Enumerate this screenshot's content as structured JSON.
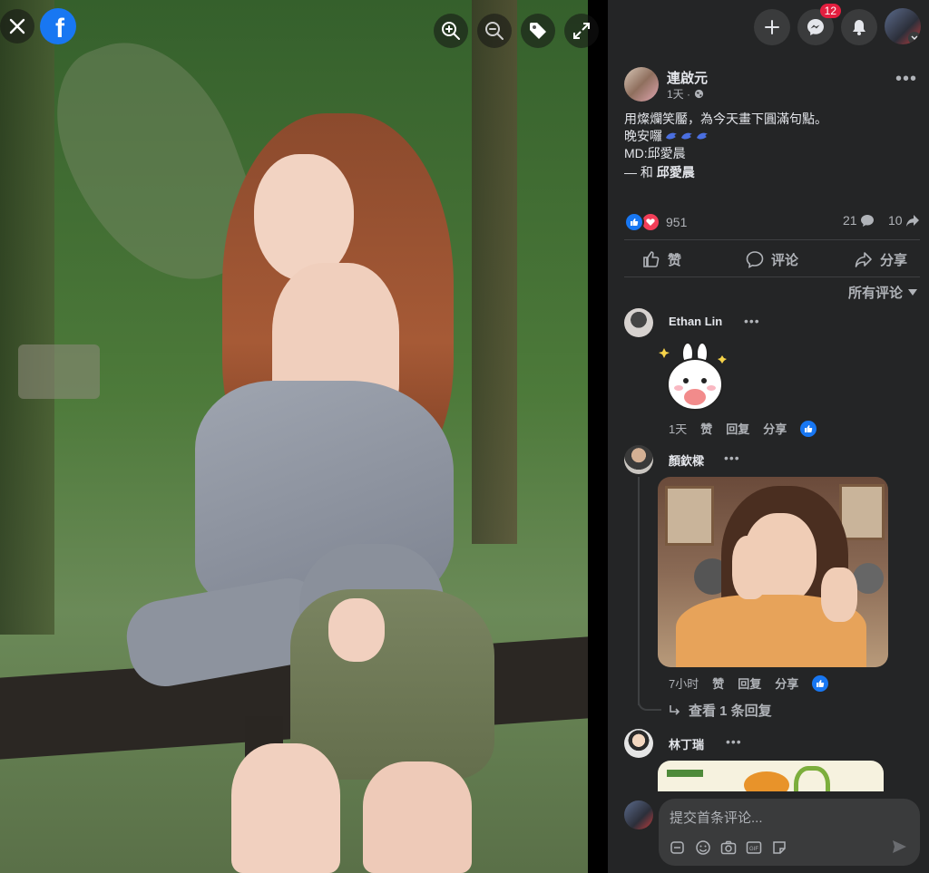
{
  "post": {
    "author": "連啟元",
    "time": "1天 ·",
    "caption_line1": "用燦爛笑靨，為今天畫下圓滿句點。",
    "caption_line2": "晚安囉",
    "caption_line3": "MD:邱愛晨",
    "with_prefix": "— 和",
    "with_name": "邱愛晨",
    "reactions_count": "951",
    "comments_count": "21",
    "shares_count": "10"
  },
  "header": {
    "messenger_badge": "12"
  },
  "actions": {
    "like": "赞",
    "comment": "评论",
    "share": "分享"
  },
  "comments_filter": "所有评论",
  "comments": [
    {
      "name": "Ethan Lin",
      "time": "1天",
      "like": "赞",
      "reply": "回复",
      "share": "分享"
    },
    {
      "name": "顏欽樑",
      "time": "7小时",
      "like": "赞",
      "reply": "回复",
      "share": "分享",
      "view_replies": "查看 1 条回复"
    },
    {
      "name": "林丁瑞"
    }
  ],
  "composer": {
    "placeholder": "提交首条评论..."
  },
  "colors": {
    "accent": "#1877f2",
    "panel": "#242526",
    "badge": "#e41e3f"
  }
}
